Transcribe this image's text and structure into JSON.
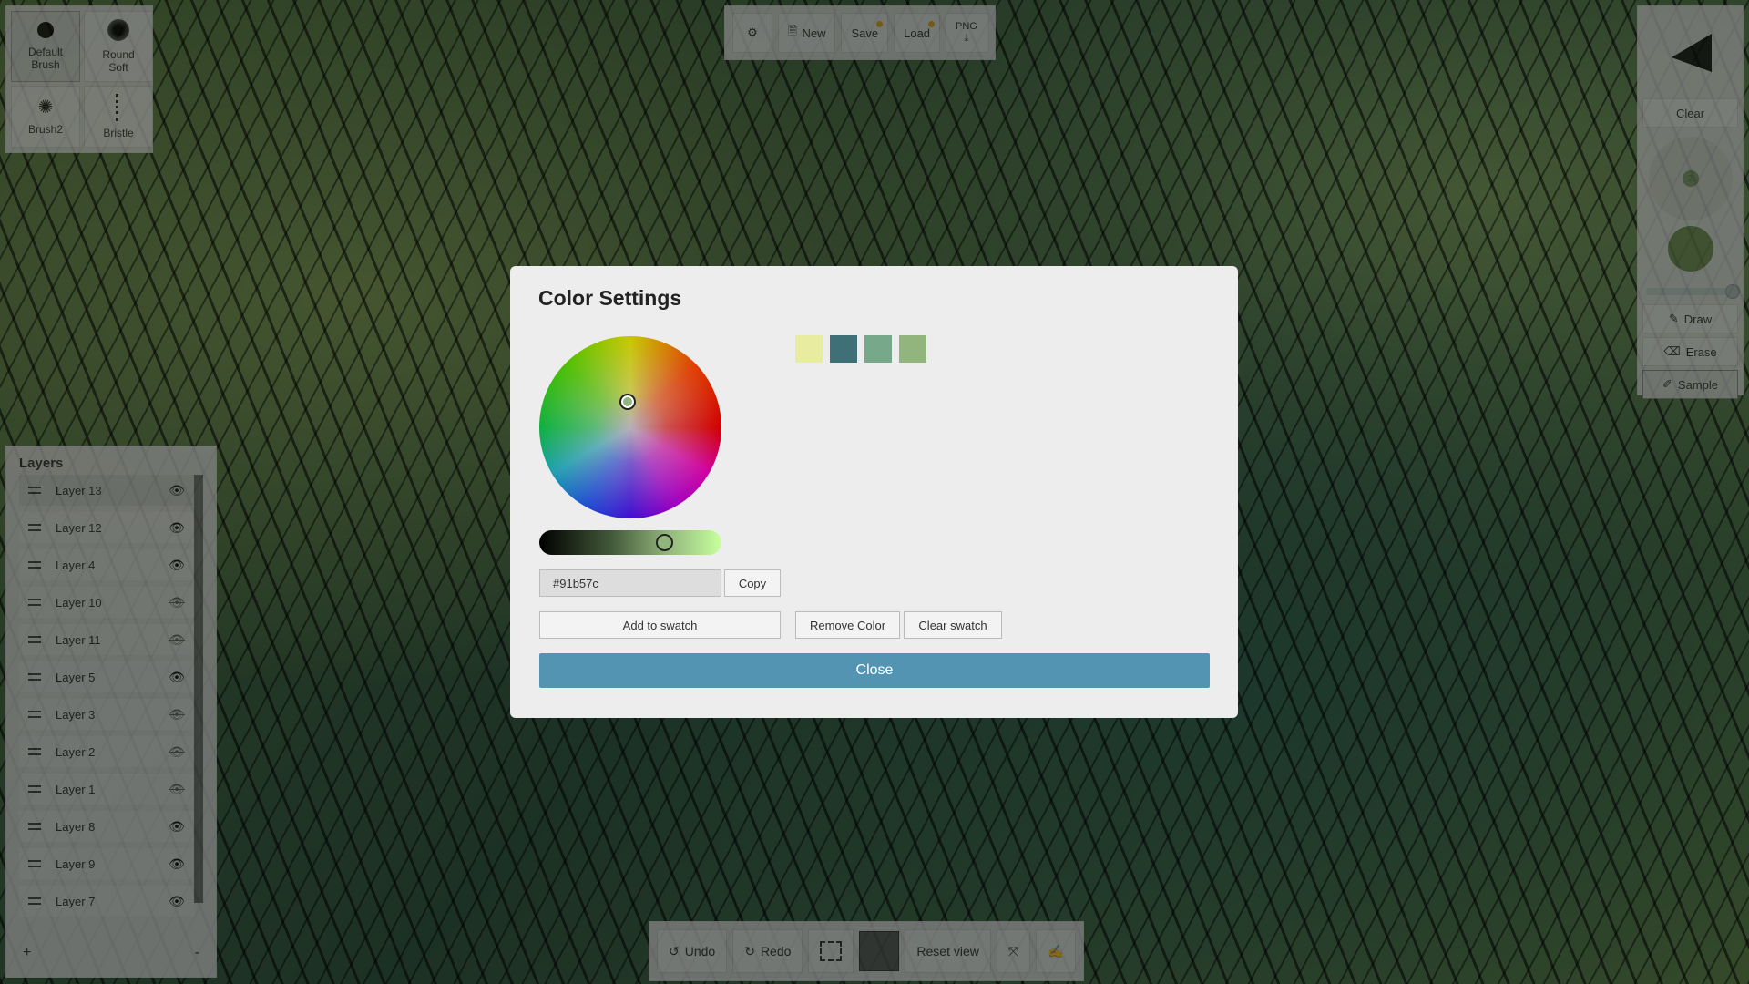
{
  "brushes": [
    {
      "label": "Default Brush",
      "line1": "Default",
      "line2": "Brush",
      "icon": "brush-dot-icon"
    },
    {
      "label": "Round Soft",
      "line1": "Round",
      "line2": "Soft",
      "icon": "brush-soft-icon"
    },
    {
      "label": "Brush2",
      "icon": "brush-splat-icon"
    },
    {
      "label": "Bristle",
      "icon": "brush-bristle-icon"
    }
  ],
  "toolbar": {
    "settings_icon": "gear-icon",
    "new_label": "New",
    "save_label": "Save",
    "load_label": "Load",
    "png_label": "PNG"
  },
  "right_panel": {
    "clear_label": "Clear",
    "brush_size": "2",
    "draw_label": "Draw",
    "erase_label": "Erase",
    "sample_label": "Sample",
    "current_color": "#6a8550"
  },
  "layers": {
    "title": "Layers",
    "items": [
      {
        "name": "Layer 13",
        "visible": true
      },
      {
        "name": "Layer 12",
        "visible": true
      },
      {
        "name": "Layer 4",
        "visible": true
      },
      {
        "name": "Layer 10",
        "visible": false
      },
      {
        "name": "Layer 11",
        "visible": false
      },
      {
        "name": "Layer 5",
        "visible": true
      },
      {
        "name": "Layer 3",
        "visible": false
      },
      {
        "name": "Layer 2",
        "visible": false
      },
      {
        "name": "Layer 1",
        "visible": false
      },
      {
        "name": "Layer 8",
        "visible": true
      },
      {
        "name": "Layer 9",
        "visible": true
      },
      {
        "name": "Layer 7",
        "visible": true
      }
    ],
    "add_label": "+",
    "remove_label": "-"
  },
  "bottom_bar": {
    "undo_label": "Undo",
    "redo_label": "Redo",
    "reset_view_label": "Reset view",
    "color_swatch": "#555555"
  },
  "modal": {
    "title": "Color Settings",
    "hex_value": "#91b57c",
    "copy_label": "Copy",
    "add_swatch_label": "Add to swatch",
    "remove_color_label": "Remove Color",
    "clear_swatch_label": "Clear swatch",
    "close_label": "Close",
    "swatches": [
      "#e8eca0",
      "#3f7078",
      "#78a88a",
      "#91b57c"
    ],
    "accent_color": "#5494b3"
  }
}
